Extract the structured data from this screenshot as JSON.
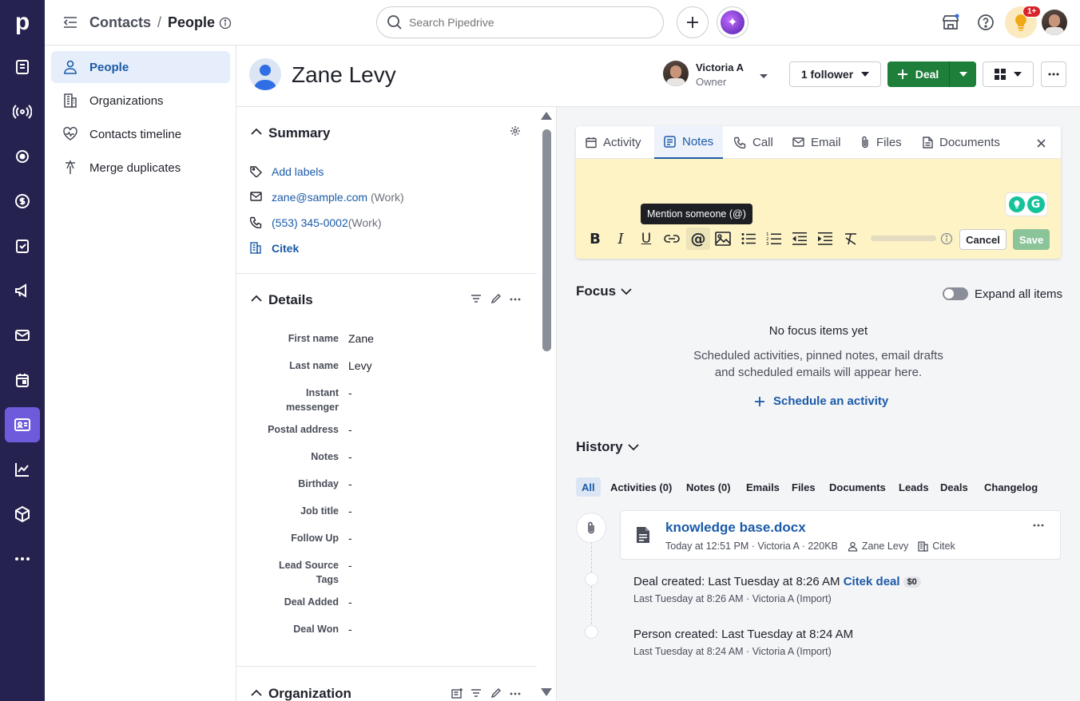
{
  "app": {
    "logo_letter": "p",
    "brand_color": "#26224f",
    "accent_color": "#6e5bdc",
    "link_color": "#1a5aa8",
    "deal_color": "#1d7f3a"
  },
  "topbar": {
    "breadcrumb_parent": "Contacts",
    "breadcrumb_sep": "/",
    "breadcrumb_current": "People",
    "search_placeholder": "Search Pipedrive",
    "notification_badge": "1+"
  },
  "sidebar": {
    "items": [
      {
        "label": "People",
        "icon": "person-icon",
        "active": true
      },
      {
        "label": "Organizations",
        "icon": "building-icon"
      },
      {
        "label": "Contacts timeline",
        "icon": "heart-pulse-icon"
      },
      {
        "label": "Merge duplicates",
        "icon": "merge-icon"
      }
    ]
  },
  "person": {
    "name": "Zane Levy",
    "owner_name": "Victoria A",
    "owner_role": "Owner",
    "followers": "1 follower",
    "deal_button": "Deal"
  },
  "summary": {
    "title": "Summary",
    "add_labels": "Add labels",
    "email": "zane@sample.com",
    "email_type": "(Work)",
    "phone": "(553) 345-0002",
    "phone_type": "(Work)",
    "organization": "Citek"
  },
  "details": {
    "title": "Details",
    "rows": [
      {
        "label": "First name",
        "value": "Zane"
      },
      {
        "label": "Last name",
        "value": "Levy"
      },
      {
        "label": "Instant messenger",
        "value": "-"
      },
      {
        "label": "Postal address",
        "value": "-"
      },
      {
        "label": "Notes",
        "value": "-"
      },
      {
        "label": "Birthday",
        "value": "-"
      },
      {
        "label": "Job title",
        "value": "-"
      },
      {
        "label": "Follow Up",
        "value": "-"
      },
      {
        "label": "Lead Source Tags",
        "value": "-"
      },
      {
        "label": "Deal Added",
        "value": "-"
      },
      {
        "label": "Deal Won",
        "value": "-"
      }
    ]
  },
  "organization_section": {
    "title": "Organization"
  },
  "composer": {
    "tabs": [
      {
        "label": "Activity",
        "icon": "calendar-icon"
      },
      {
        "label": "Notes",
        "icon": "note-icon",
        "active": true
      },
      {
        "label": "Call",
        "icon": "phone-icon"
      },
      {
        "label": "Email",
        "icon": "envelope-icon"
      },
      {
        "label": "Files",
        "icon": "paperclip-icon"
      },
      {
        "label": "Documents",
        "icon": "document-icon"
      }
    ],
    "tooltip": "Mention someone (@)",
    "cancel": "Cancel",
    "save": "Save",
    "note_bg": "#fdf3c4"
  },
  "focus": {
    "title": "Focus",
    "expand_label": "Expand all items",
    "empty_title": "No focus items yet",
    "empty_line1": "Scheduled activities, pinned notes, email drafts",
    "empty_line2": "and scheduled emails will appear here.",
    "schedule_link": "Schedule an activity"
  },
  "history": {
    "title": "History",
    "filters": [
      "All",
      "Activities (0)",
      "Notes (0)",
      "Emails",
      "Files",
      "Documents",
      "Leads",
      "Deals",
      "Changelog"
    ],
    "file": {
      "name": "knowledge base.docx",
      "meta": "Today at 12:51 PM · Victoria A · 220KB",
      "person": "Zane Levy",
      "org": "Citek"
    },
    "events": [
      {
        "prefix": "Deal created",
        "sep": ":",
        "when": "Last Tuesday at 8:26 AM",
        "link": "Citek deal",
        "badge": "$0",
        "meta": "Last Tuesday at 8:26 AM · Victoria A (Import)"
      },
      {
        "prefix": "Person created",
        "sep": ":",
        "when": "Last Tuesday at 8:24 AM",
        "link": "",
        "badge": "",
        "meta": "Last Tuesday at 8:24 AM · Victoria A (Import)"
      }
    ]
  }
}
